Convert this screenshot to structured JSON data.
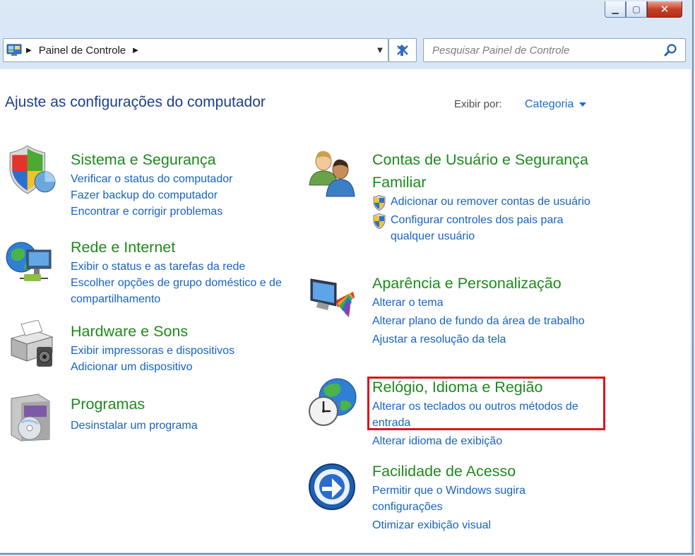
{
  "window": {
    "minimize_glyph": "▁",
    "maximize_glyph": "▢",
    "close_glyph": "✕"
  },
  "address_bar": {
    "breadcrumb": "Painel de Controle",
    "dropdown_icon": "chevron-down-icon",
    "refresh_icon": "refresh-icon"
  },
  "search": {
    "placeholder": "Pesquisar Painel de Controle",
    "icon": "search-icon"
  },
  "page": {
    "title": "Ajuste as configurações do computador",
    "view_by_label": "Exibir por:",
    "view_by_value": "Categoria"
  },
  "categories": [
    {
      "icon": "shield-icon",
      "title": "Sistema e Segurança",
      "links": [
        "Verificar o status do computador",
        "Fazer backup do computador",
        "Encontrar e corrigir problemas"
      ]
    },
    {
      "icon": "network-globe-icon",
      "title": "Rede e Internet",
      "links": [
        "Exibir o status e as tarefas da rede",
        "Escolher opções de grupo doméstico e de compartilhamento"
      ]
    },
    {
      "icon": "printer-icon",
      "title": "Hardware e Sons",
      "links": [
        "Exibir impressoras e dispositivos",
        "Adicionar um dispositivo"
      ]
    },
    {
      "icon": "programs-disc-icon",
      "title": "Programas",
      "links": [
        "Desinstalar um programa"
      ]
    },
    {
      "icon": "users-icon",
      "title": "Contas de Usuário e Segurança Familiar",
      "links": [
        "Adicionar ou remover contas de usuário",
        "Configurar controles dos pais para qualquer usuário"
      ]
    },
    {
      "icon": "appearance-monitor-icon",
      "title": "Aparência e Personalização",
      "links": [
        "Alterar o tema",
        "Alterar plano de fundo da área de trabalho",
        "Ajustar a resolução da tela"
      ]
    },
    {
      "icon": "clock-globe-icon",
      "title": "Relógio, Idioma e Região",
      "links": [
        "Alterar os teclados ou outros métodos de entrada",
        "Alterar idioma de exibição"
      ]
    },
    {
      "icon": "ease-of-access-icon",
      "title": "Facilidade de Acesso",
      "links": [
        "Permitir que o Windows sugira configurações",
        "Otimizar exibição visual"
      ]
    }
  ],
  "colors": {
    "category_title": "#1d8a1d",
    "link": "#1762c4",
    "highlight_box": "#d9161c"
  }
}
